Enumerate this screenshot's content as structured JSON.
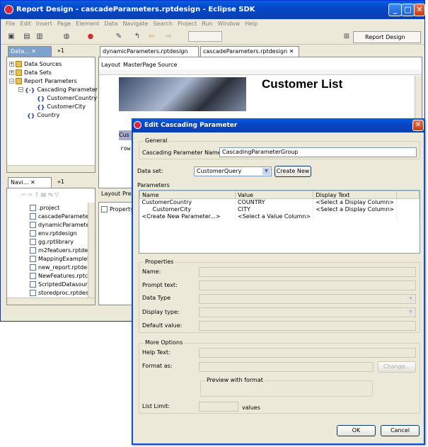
{
  "window": {
    "title": "Report Design - cascadeParameters.rptdesign - Eclipse SDK"
  },
  "menu": [
    "File",
    "Edit",
    "Insert",
    "Page",
    "Element",
    "Data",
    "Navigate",
    "Search",
    "Project",
    "Run",
    "Window",
    "Help"
  ],
  "perspective": {
    "label": "Report Design"
  },
  "data_explorer": {
    "tab_label": "Data...",
    "tab_overflow": "»1",
    "items": [
      {
        "label": "Data Sources"
      },
      {
        "label": "Data Sets"
      },
      {
        "label": "Report Parameters"
      },
      {
        "label": "Cascading Parameter"
      },
      {
        "label": "CustomerCountry"
      },
      {
        "label": "CustomerCity"
      },
      {
        "label": "Country"
      }
    ]
  },
  "navigator": {
    "tab_label": "Navi...",
    "tab_overflow": "»1",
    "files": [
      ".project",
      "cascadeParameter",
      "dynamicParamete",
      "env.rptdesign",
      "gg.rptlibrary",
      "m2featuers.rptde",
      "MappingExampleB",
      "new_report.rptde",
      "NewFeatures.rptc",
      "ScriptedDatasourc",
      "storedproc.rptdes"
    ]
  },
  "editor": {
    "tabs": [
      "dynamicParameters.rptdesign",
      "cascadeParameters.rptdesign"
    ],
    "subtabs": [
      "Layout",
      "MasterPage",
      "Source"
    ],
    "report_title": "Customer List",
    "cell_text": "Cus",
    "row_text": "row",
    "bottom_tabs": [
      "Layout",
      "Pre"
    ],
    "property_tab": "Property"
  },
  "dialog": {
    "title": "Edit Cascading Parameter",
    "general_label": "General",
    "name_label": "Cascading Parameter Name:",
    "name_value": "CascadingParameterGroup",
    "dataset_label": "Data set:",
    "dataset_value": "CustomerQuery",
    "create_new": "Create New",
    "parameters_label": "Parameters",
    "columns": [
      "Name",
      "Value",
      "Display Text"
    ],
    "rows": [
      {
        "name": "CustomerCountry",
        "value": "COUNTRY",
        "display": "<Select a Display Column>"
      },
      {
        "name": "CustomerCity",
        "value": "CITY",
        "display": "<Select a Display Column>"
      },
      {
        "name": "<Create New Parameter...>",
        "value": "<Select a Value Column>",
        "display": ""
      }
    ],
    "properties_label": "Properties",
    "prop_name": "Name:",
    "prop_prompt": "Prompt text:",
    "prop_type": "Data Type",
    "prop_display_type": "Display type:",
    "prop_default": "Default value:",
    "more_options_label": "More Options",
    "help_text": "Help Text:",
    "format_as": "Format as:",
    "change": "Change...",
    "preview_label": "Preview with format",
    "list_limit": "List Limit:",
    "values": "values",
    "ok": "OK",
    "cancel": "Cancel"
  }
}
